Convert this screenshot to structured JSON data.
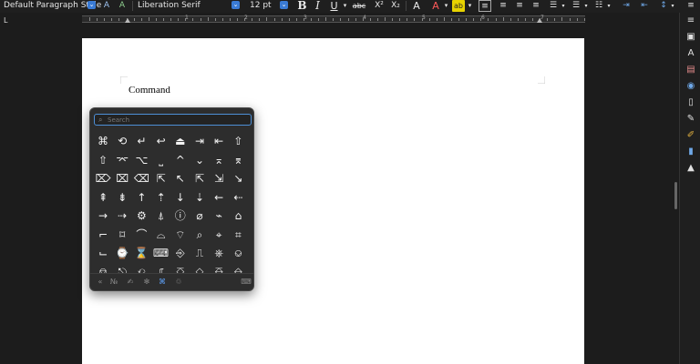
{
  "toolbar": {
    "paragraph_style": "Default Paragraph Style",
    "font_name": "Liberation Serif",
    "font_size": "12 pt",
    "bold": "B",
    "italic": "I",
    "underline": "U",
    "strikethrough": "abc",
    "superscript": "X²",
    "subscript": "X₂"
  },
  "ruler": {
    "numbers": [
      "1",
      "2",
      "3",
      "4",
      "5",
      "6",
      "7"
    ],
    "tab_stop": "L"
  },
  "document": {
    "text": "Command"
  },
  "popup": {
    "search_placeholder": "Search",
    "glyphs": [
      [
        "⌘",
        "⟲",
        "↵",
        "↩",
        "⏏",
        "⇥",
        "⇤",
        "⇧"
      ],
      [
        "⇧",
        "⌤",
        "⌥",
        "⎵",
        "^",
        "⌄",
        "⌅",
        "⌆"
      ],
      [
        "⌦",
        "⌧",
        "⌫",
        "⇱",
        "↖",
        "⇱",
        "⇲",
        "↘"
      ],
      [
        "⇞",
        "⇟",
        "↑",
        "⇡",
        "↓",
        "⇣",
        "←",
        "⇠"
      ],
      [
        "→",
        "⇢",
        "⚙",
        "⍋",
        "ⓘ",
        "⌀",
        "⌁",
        "⌂"
      ],
      [
        "⌐",
        "⌑",
        "⌒",
        "⌓",
        "⌔",
        "⌕",
        "⌖",
        "⌗"
      ],
      [
        "⌙",
        "⌚",
        "⌛",
        "⌨",
        "⎆",
        "⎍",
        "⎈",
        "⎉"
      ],
      [
        "⎊",
        "⎋",
        "⎌",
        "⎎",
        "⎏",
        "⎐",
        "⎑",
        "⎒"
      ]
    ],
    "categories": [
      "«",
      "№",
      "✍",
      "✻",
      "⌘",
      "♲"
    ],
    "active_category": 4,
    "keyboard_icon": "⌨"
  },
  "colors": {
    "accent": "#5b9cf0",
    "popup_bg": "#2d2d2d",
    "page": "#ffffff"
  }
}
